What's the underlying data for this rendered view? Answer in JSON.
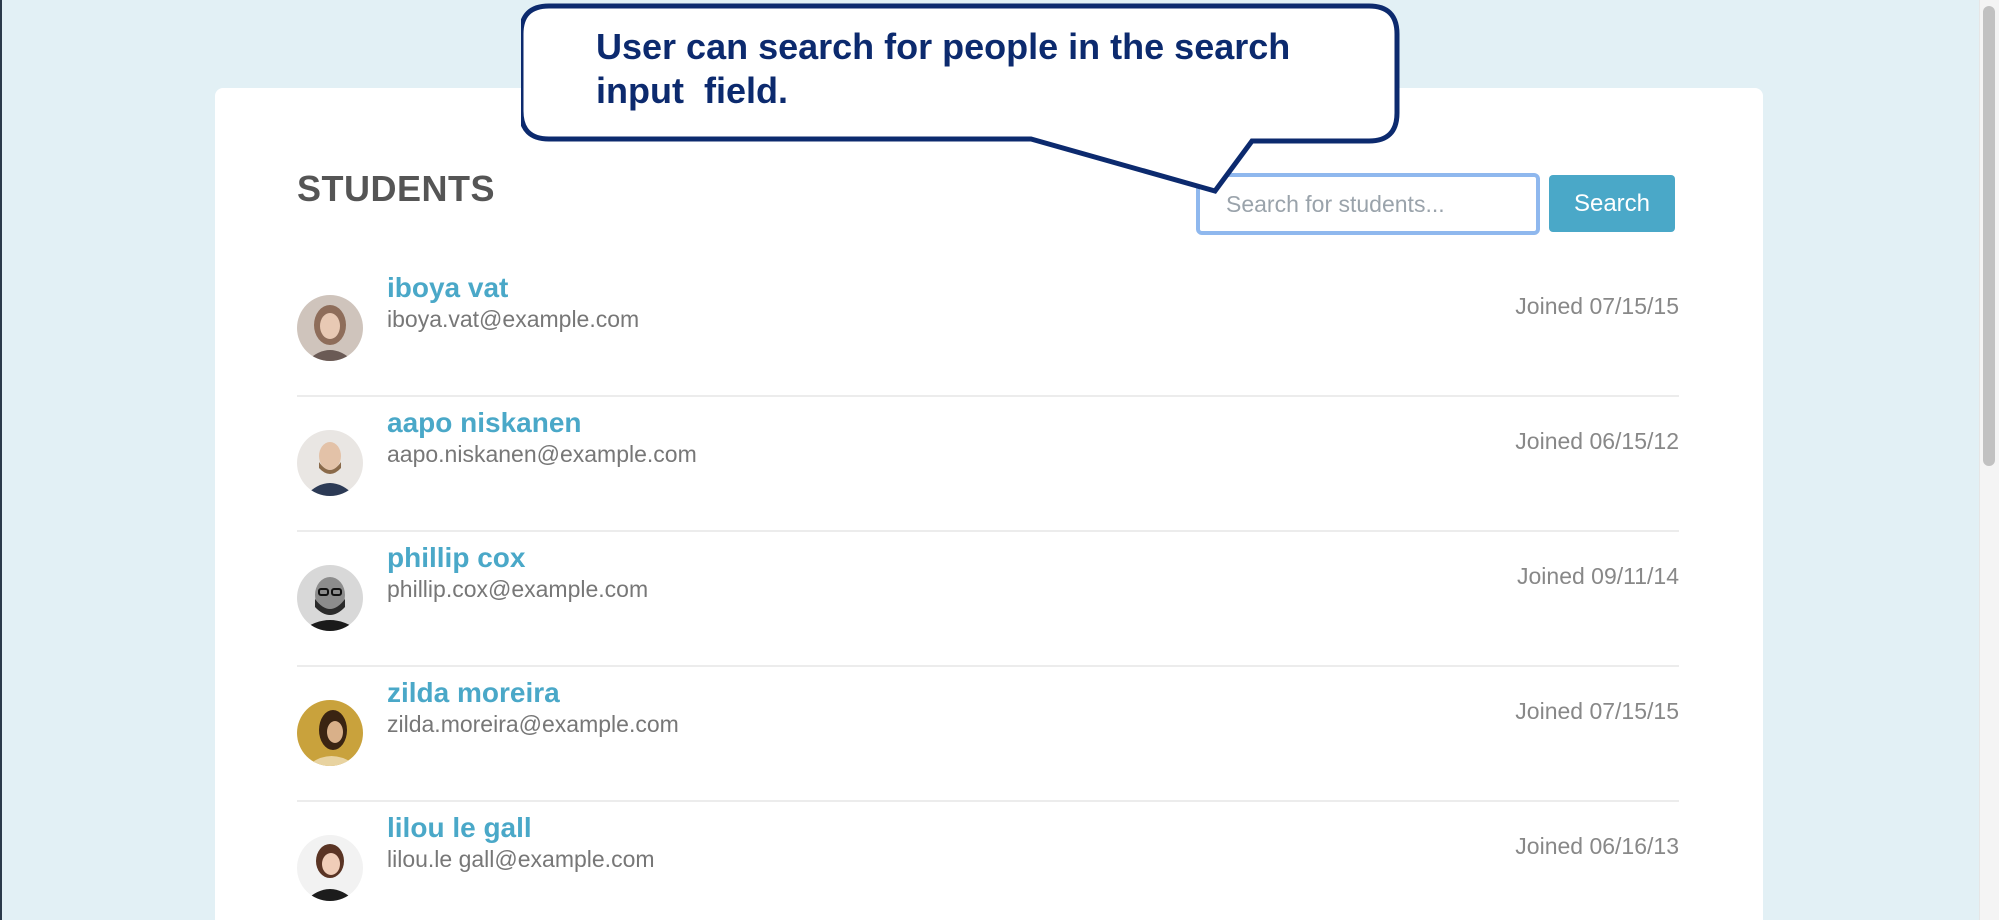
{
  "header": {
    "title": "STUDENTS"
  },
  "search": {
    "placeholder": "Search for students...",
    "button_label": "Search"
  },
  "callout": {
    "text": "User can search for people in the search input  field."
  },
  "students": [
    {
      "name": "iboya vat",
      "email": "iboya.vat@example.com",
      "joined": "Joined 07/15/15",
      "avatar_color": "#b7a08f"
    },
    {
      "name": "aapo niskanen",
      "email": "aapo.niskanen@example.com",
      "joined": "Joined 06/15/12",
      "avatar_color": "#c9b8a6"
    },
    {
      "name": "phillip cox",
      "email": "phillip.cox@example.com",
      "joined": "Joined 09/11/14",
      "avatar_color": "#3a3a3a"
    },
    {
      "name": "zilda moreira",
      "email": "zilda.moreira@example.com",
      "joined": "Joined 07/15/15",
      "avatar_color": "#8a6a2a"
    },
    {
      "name": "lilou le gall",
      "email": "lilou.le gall@example.com",
      "joined": "Joined 06/16/13",
      "avatar_color": "#6b4a3a"
    }
  ],
  "colors": {
    "background": "#e2f0f5",
    "accent": "#4aa8c8",
    "callout_border": "#0c2a6e"
  }
}
